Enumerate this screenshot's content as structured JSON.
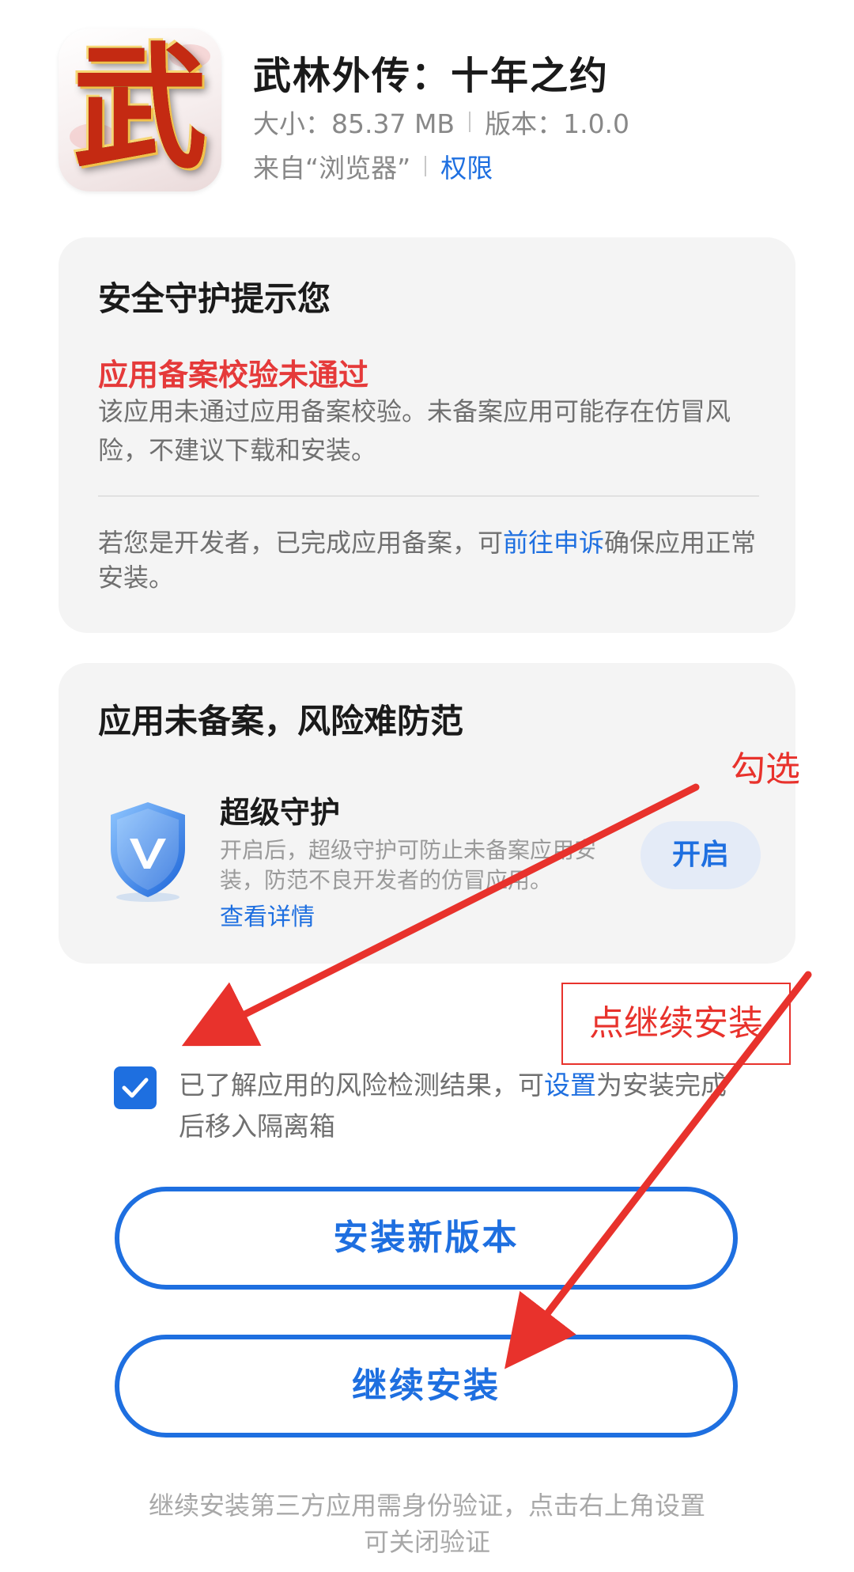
{
  "app": {
    "icon": "wu-character-game-icon",
    "icon_glyph": "武",
    "title": "武林外传：十年之约",
    "size_label": "大小：85.37 MB",
    "version_label": "版本：1.0.0",
    "source_label": "来自“浏览器”",
    "permissions_link": "权限"
  },
  "security_card": {
    "title": "安全守护提示您",
    "warning_title": "应用备案校验未通过",
    "warning_body": "该应用未通过应用备案校验。未备案应用可能存在仿冒风险，不建议下载和安装。",
    "dev_note_prefix": "若您是开发者，已完成应用备案，可",
    "dev_note_link": "前往申诉",
    "dev_note_suffix": "确保应用正常安装。"
  },
  "guard_card": {
    "title": "应用未备案，风险难防范",
    "guard_icon": "shield-v-icon",
    "guard_title": "超级守护",
    "guard_desc": "开启后，超级守护可防止未备案应用安装，防范不良开发者的仿冒应用。",
    "guard_more": "查看详情",
    "enable_button": "开启"
  },
  "acknowledge": {
    "checked": true,
    "text_prefix": "已了解应用的风险检测结果，可",
    "text_link": "设置",
    "text_suffix": "为安装完成后移入隔离箱"
  },
  "buttons": {
    "install_new": "安装新版本",
    "continue_install": "继续安装"
  },
  "footer": {
    "note": "继续安装第三方应用需身份验证，点击右上角设置可关闭验证"
  },
  "annotations": {
    "check_label": "勾选",
    "click_label": "点继续安装",
    "color": "#e8322c"
  },
  "colors": {
    "accent": "#1e6fe0",
    "warning": "#e53a3a",
    "card_bg": "#f4f4f4"
  }
}
